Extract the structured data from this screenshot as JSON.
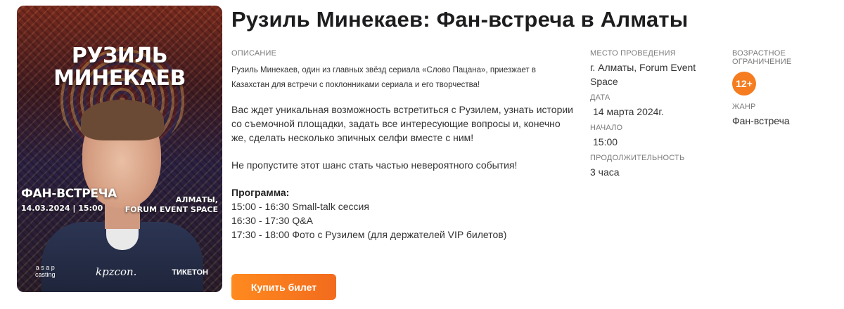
{
  "poster": {
    "name_line1": "РУЗИЛЬ",
    "name_line2": "МИНЕКАЕВ",
    "fan_meeting": "ФАН-ВСТРЕЧА",
    "date_time": "14.03.2024 | 15:00",
    "venue_line1": "АЛМАТЫ,",
    "venue_line2": "FORUM EVENT SPACE",
    "logo_asap_1": "a s a p",
    "logo_asap_2": "casting",
    "logo_kpzcon": "kpzcon.",
    "logo_ticketon": "ТИКЕТОН"
  },
  "title": "Рузиль Минекаев: Фан-встреча в Алматы",
  "description": {
    "label": "ОПИСАНИЕ",
    "short": "Рузиль Минекаев, один из главных звёзд сериала «Слово Пацана», приезжает в Казахстан для встречи с поклонниками сериала и его творчества!",
    "p1": "Вас ждет уникальная возможность встретиться с Рузилем, узнать истории со съемочной площадки, задать все интересующие вопросы и, конечно же, сделать несколько эпичных селфи вместе с ним!",
    "p2": "Не пропустите этот шанс стать частью невероятного события!",
    "program_title": "Программа:",
    "program": [
      "15:00 - 16:30 Small-talk сессия",
      "16:30 - 17:30 Q&A",
      "17:30 - 18:00 Фото с Рузилем (для держателей VIP билетов)"
    ]
  },
  "buy_button": "Купить билет",
  "info": {
    "venue_label": "МЕСТО ПРОВЕДЕНИЯ",
    "venue": "г. Алматы, Forum Event Space",
    "date_label": "ДАТА",
    "date": "14 марта  2024г.",
    "start_label": "НАЧАЛО",
    "start": "15:00",
    "duration_label": "ПРОДОЛЖИТЕЛЬНОСТЬ",
    "duration": "3 часа",
    "age_label": "ВОЗРАСТНОЕ ОГРАНИЧЕНИЕ",
    "age": "12+",
    "genre_label": "ЖАНР",
    "genre": "Фан-встреча"
  },
  "colors": {
    "accent": "#f57c1f",
    "button_gradient_start": "#ff8a1f",
    "button_gradient_end": "#f26b1d"
  }
}
